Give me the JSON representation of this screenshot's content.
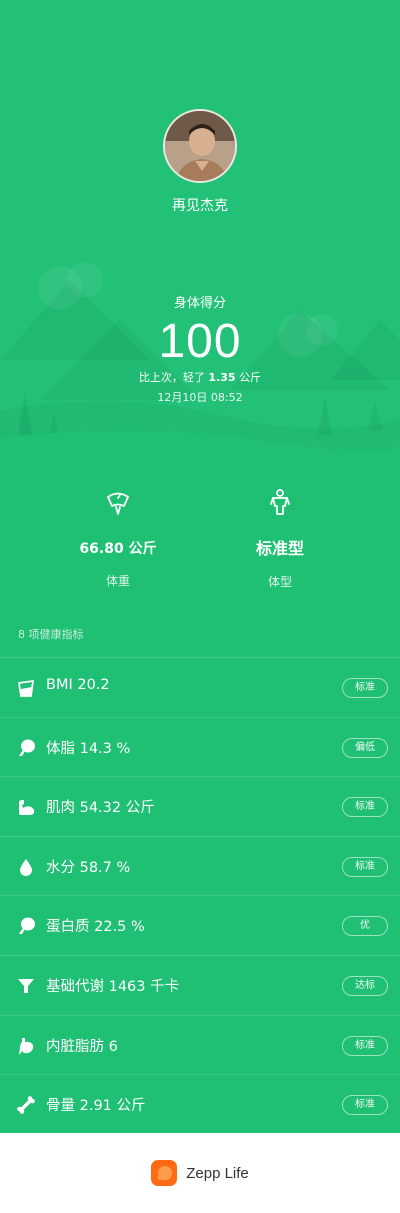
{
  "profile": {
    "username": "再见杰克"
  },
  "score": {
    "label": "身体得分",
    "value": "100",
    "compare_prefix": "比上次，轻了",
    "compare_value": "1.35",
    "compare_unit": "公斤",
    "datetime": "12月10日 08:52"
  },
  "stats": [
    {
      "icon": "scale-icon",
      "value": "66.80 公斤",
      "label": "体重"
    },
    {
      "icon": "body-type-icon",
      "value": "标准型",
      "label": "体型"
    }
  ],
  "metrics_title": "8 项健康指标",
  "metrics": [
    {
      "icon": "bmi-icon",
      "text": "BMI 20.2",
      "status": "标准"
    },
    {
      "icon": "body-fat-icon",
      "text": "体脂 14.3 %",
      "status": "偏低"
    },
    {
      "icon": "muscle-icon",
      "text": "肌肉 54.32 公斤",
      "status": "标准"
    },
    {
      "icon": "water-drop-icon",
      "text": "水分 58.7 %",
      "status": "标准"
    },
    {
      "icon": "protein-icon",
      "text": "蛋白质 22.5 %",
      "status": "优"
    },
    {
      "icon": "funnel-icon",
      "text": "基础代谢 1463 千卡",
      "status": "达标"
    },
    {
      "icon": "stomach-icon",
      "text": "内脏脂肪 6",
      "status": "标准"
    },
    {
      "icon": "bone-icon",
      "text": "骨量 2.91 公斤",
      "status": "标准"
    }
  ],
  "footer": {
    "brand": "Zepp Life"
  },
  "colors": {
    "background": "#1fbf74",
    "brand_orange": "#ff6a13"
  }
}
